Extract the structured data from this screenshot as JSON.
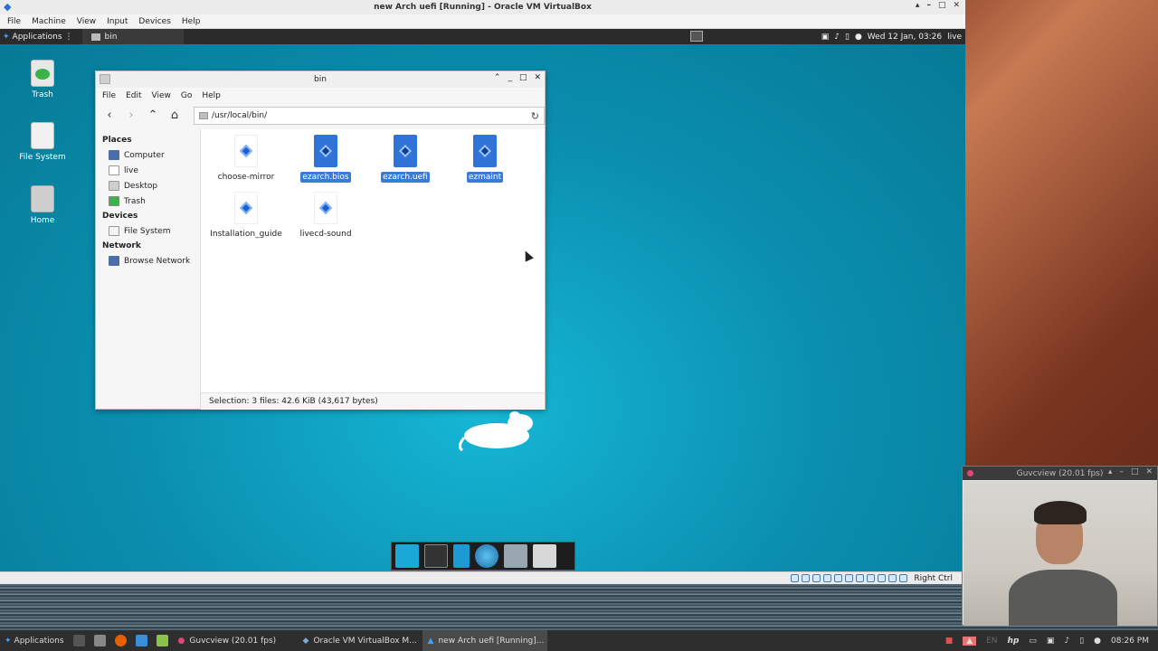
{
  "host": {
    "vbox_title": "new Arch uefi [Running] - Oracle VM VirtualBox",
    "vbox_menu": [
      "File",
      "Machine",
      "View",
      "Input",
      "Devices",
      "Help"
    ],
    "vbox_status": {
      "host_key": "Right Ctrl"
    },
    "webcam": {
      "title": "Guvcview  (20.01 fps)"
    },
    "taskbar": {
      "start_label": "Applications",
      "tasks": [
        {
          "label": "Guvcview  (20.01 fps)"
        },
        {
          "label": "Oracle VM VirtualBox M..."
        },
        {
          "label": "new Arch uefi [Running]..."
        }
      ],
      "clock": "08:26 PM",
      "lang": "EN"
    }
  },
  "guest": {
    "panel": {
      "apps_label": "Applications",
      "task_label": "bin",
      "datetime": "Wed 12 Jan, 03:26",
      "user": "live"
    },
    "desktop_icons": [
      {
        "label": "Trash"
      },
      {
        "label": "File System"
      },
      {
        "label": "Home"
      }
    ],
    "file_manager": {
      "title": "bin",
      "menu": [
        "File",
        "Edit",
        "View",
        "Go",
        "Help"
      ],
      "path": "/usr/local/bin/",
      "sidebar": {
        "places_header": "Places",
        "places": [
          "Computer",
          "live",
          "Desktop",
          "Trash"
        ],
        "devices_header": "Devices",
        "devices": [
          "File System"
        ],
        "network_header": "Network",
        "network": [
          "Browse Network"
        ]
      },
      "files": [
        {
          "name": "choose-mirror",
          "selected": false
        },
        {
          "name": "ezarch.bios",
          "selected": true
        },
        {
          "name": "ezarch.uefi",
          "selected": true
        },
        {
          "name": "ezmaint",
          "selected": true
        },
        {
          "name": "Installation_guide",
          "selected": false
        },
        {
          "name": "livecd-sound",
          "selected": false
        }
      ],
      "status": "Selection: 3 files: 42.6 KiB (43,617 bytes)"
    }
  }
}
